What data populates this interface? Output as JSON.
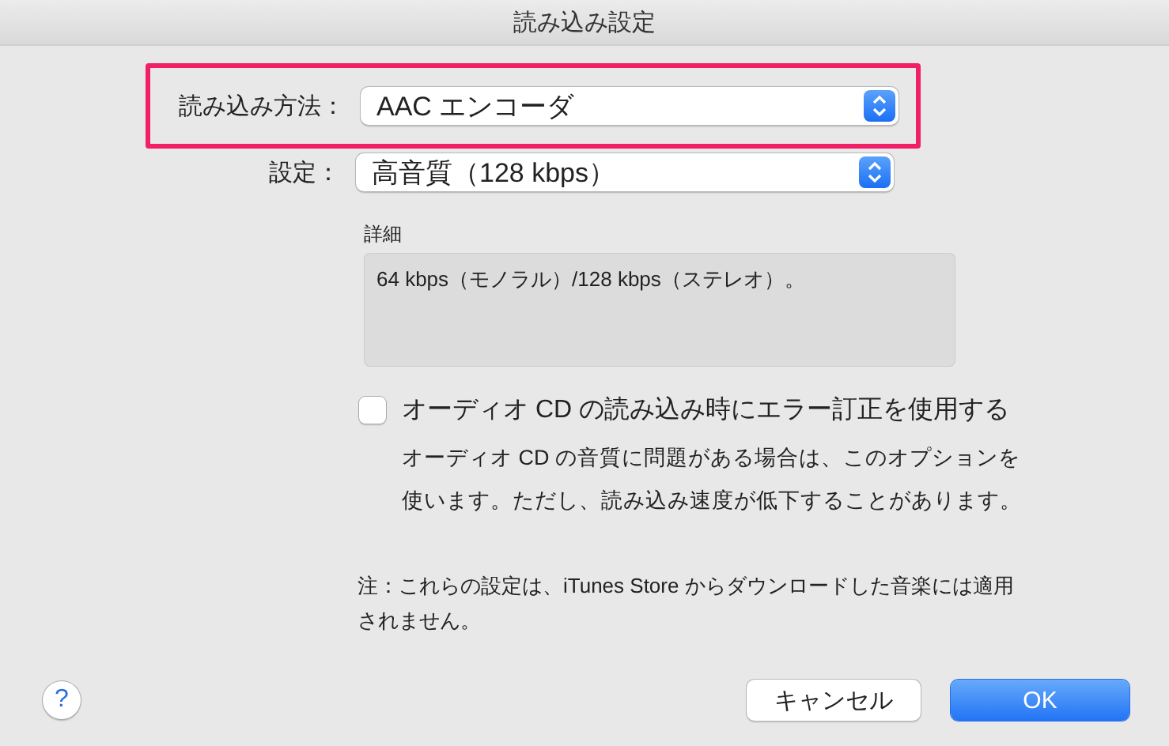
{
  "window": {
    "title": "読み込み設定"
  },
  "settings": [
    {
      "label": "読み込み方法：",
      "value": "AAC エンコーダ",
      "highlighted": true
    },
    {
      "label": "設定：",
      "value": "高音質（128 kbps）",
      "highlighted": false
    }
  ],
  "details": {
    "label": "詳細",
    "text": "64 kbps（モノラル）/128 kbps（ステレオ）。"
  },
  "error_correction": {
    "label": "オーディオ CD の読み込み時にエラー訂正を使用する",
    "checked": false,
    "description": "オーディオ CD の音質に問題がある場合は、このオプションを使います。ただし、読み込み速度が低下することがあります。"
  },
  "note": "注：これらの設定は、iTunes Store からダウンロードした音楽には適用されません。",
  "help_button": "?",
  "buttons": [
    {
      "label": "キャンセル",
      "kind": "secondary"
    },
    {
      "label": "OK",
      "kind": "default"
    }
  ]
}
